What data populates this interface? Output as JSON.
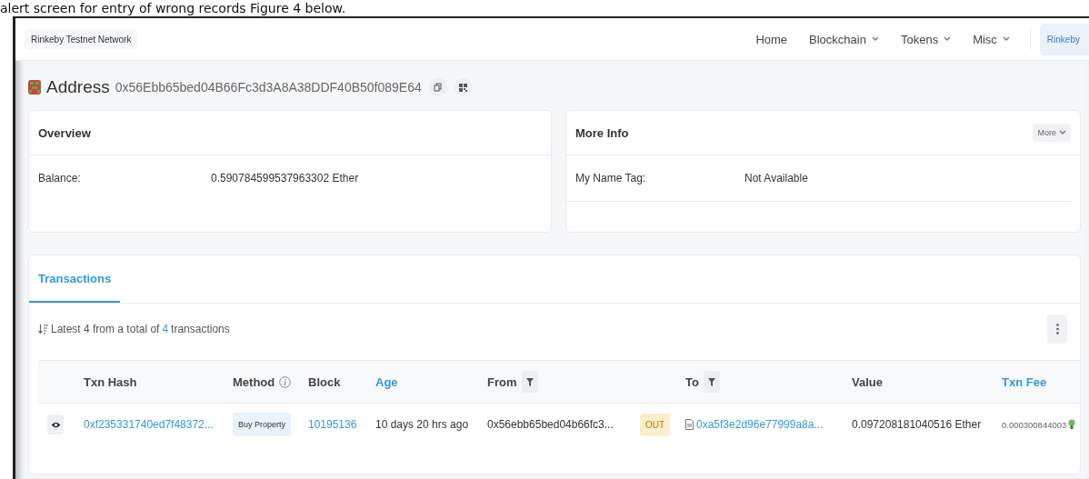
{
  "caption": "alert screen for entry of wrong records Figure 4 below.",
  "header": {
    "network": "Rinkeby Testnet Network",
    "nav": [
      {
        "label": "Home",
        "dropdown": false
      },
      {
        "label": "Blockchain",
        "dropdown": true
      },
      {
        "label": "Tokens",
        "dropdown": true
      },
      {
        "label": "Misc",
        "dropdown": true
      }
    ],
    "network_button": "Rinkeby"
  },
  "address": {
    "label": "Address",
    "value": "0x56Ebb65bed04B66Fc3d3A8A38DDF40B50f089E64"
  },
  "overview": {
    "title": "Overview",
    "rows": [
      {
        "label": "Balance:",
        "value": "0.590784599537963302 Ether"
      }
    ]
  },
  "more_info": {
    "title": "More Info",
    "button": "More",
    "rows": [
      {
        "label": "My Name Tag:",
        "value": "Not Available"
      }
    ]
  },
  "transactions": {
    "tabs": [
      {
        "label": "Transactions",
        "selected": true
      }
    ],
    "summary": {
      "prefix": "Latest 4 from a total of",
      "count": "4",
      "suffix": "transactions"
    },
    "columns": [
      {
        "label": "Txn Hash",
        "kind": "plain"
      },
      {
        "label": "Method",
        "kind": "info"
      },
      {
        "label": "Block",
        "kind": "plain"
      },
      {
        "label": "Age",
        "kind": "link"
      },
      {
        "label": "From",
        "kind": "filter"
      },
      {
        "label": "To",
        "kind": "filter"
      },
      {
        "label": "Value",
        "kind": "plain"
      },
      {
        "label": "Txn Fee",
        "kind": "link"
      }
    ],
    "rows": [
      {
        "hash": "0xf235331740ed7f48372...",
        "method": "Buy Property",
        "block": "10195136",
        "age": "10 days 20 hrs ago",
        "from": "0x56ebb65bed04b66fc3...",
        "direction": "OUT",
        "to": "0xa5f3e2d96e77999a8a...",
        "value": "0.097208181040516 Ether",
        "fee": "0.000300844003"
      }
    ]
  }
}
